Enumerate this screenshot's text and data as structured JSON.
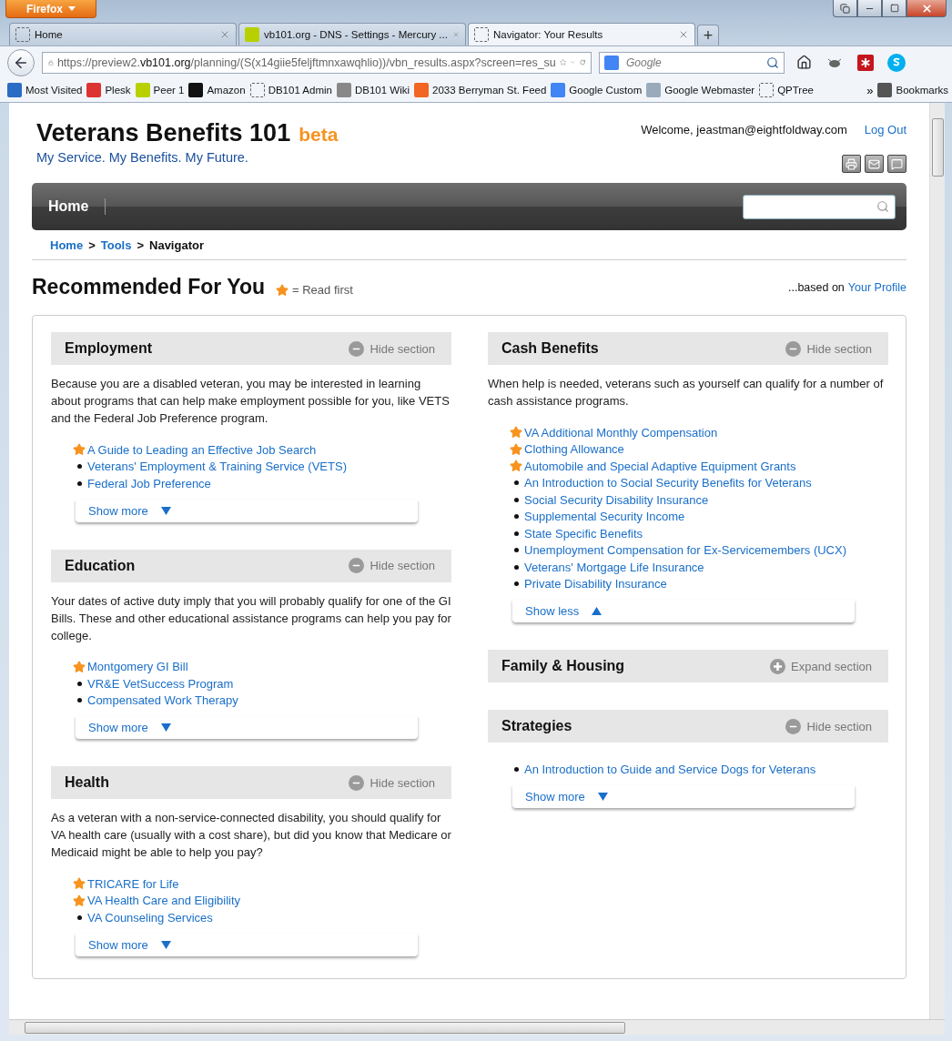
{
  "browser": {
    "app_button": "Firefox",
    "tabs": [
      {
        "title": "Home",
        "selected": false
      },
      {
        "title": "vb101.org - DNS - Settings - Mercury ...",
        "selected": false
      },
      {
        "title": "Navigator: Your Results",
        "selected": true
      }
    ],
    "new_tab": "+",
    "url": {
      "prefix": "https://preview2.",
      "domain": "vb101.org",
      "rest": "/planning/(S(x14giie5feljftmnxawqhlio))/vbn_results.aspx?screen=res_su"
    },
    "search_placeholder": "Google",
    "bookmarks": [
      "Most Visited",
      "Plesk",
      "Peer 1",
      "Amazon",
      "DB101 Admin",
      "DB101 Wiki",
      "2033 Berryman St. Feed",
      "Google Custom",
      "Google Webmaster",
      "QPTree"
    ],
    "overflow": "»",
    "bookmarks_menu": "Bookmarks"
  },
  "site": {
    "title": "Veterans Benefits 101",
    "badge": "beta",
    "tagline": "My Service. My Benefits. My Future.",
    "welcome": "Welcome, jeastman@eightfoldway.com",
    "logout": "Log Out"
  },
  "nav": [
    {
      "label": "Home",
      "selected": true
    }
  ],
  "breadcrumb": [
    {
      "label": "Home",
      "current": false
    },
    {
      "label": "Tools",
      "current": false
    },
    {
      "label": "Navigator",
      "current": true
    }
  ],
  "breadcrumb_separator": ">",
  "heading": "Recommended For You",
  "legend": "= Read first",
  "profile_note": "...based on",
  "profile_link": "Your Profile",
  "columns": [
    [
      {
        "title": "Employment",
        "toggle": "Hide section",
        "expanded": true,
        "description": "Because you are a disabled veteran, you may be interested in learning about programs that can help make employment possible for you, like VETS and the Federal Job Preference program.",
        "links": [
          {
            "label": "A Guide to Leading an Effective Job Search",
            "starred": true
          },
          {
            "label": "Veterans' Employment & Training Service (VETS)",
            "starred": false
          },
          {
            "label": "Federal Job Preference",
            "starred": false
          }
        ],
        "more": {
          "label": "Show more",
          "expanded": false
        }
      },
      {
        "title": "Education",
        "toggle": "Hide section",
        "expanded": true,
        "description": "Your dates of active duty imply that you will probably qualify for one of the GI Bills. These and other educational assistance programs can help you pay for college.",
        "links": [
          {
            "label": "Montgomery GI Bill",
            "starred": true
          },
          {
            "label": "VR&E VetSuccess Program",
            "starred": false
          },
          {
            "label": "Compensated Work Therapy",
            "starred": false
          }
        ],
        "more": {
          "label": "Show more",
          "expanded": false
        }
      },
      {
        "title": "Health",
        "toggle": "Hide section",
        "expanded": true,
        "description": "As a veteran with a non-service-connected disability, you should qualify for VA health care (usually with a cost share), but did you know that Medicare or Medicaid might be able to help you pay?",
        "links": [
          {
            "label": "TRICARE for Life",
            "starred": true
          },
          {
            "label": "VA Health Care and Eligibility",
            "starred": true
          },
          {
            "label": "VA Counseling Services",
            "starred": false
          }
        ],
        "more": {
          "label": "Show more",
          "expanded": false
        }
      }
    ],
    [
      {
        "title": "Cash Benefits",
        "toggle": "Hide section",
        "expanded": true,
        "description": "When help is needed, veterans such as yourself can qualify for a number of cash assistance programs.",
        "links": [
          {
            "label": "VA Additional Monthly Compensation",
            "starred": true
          },
          {
            "label": "Clothing Allowance",
            "starred": true
          },
          {
            "label": "Automobile and Special Adaptive Equipment Grants",
            "starred": true
          },
          {
            "label": "An Introduction to Social Security Benefits for Veterans",
            "starred": false
          },
          {
            "label": "Social Security Disability Insurance",
            "starred": false
          },
          {
            "label": "Supplemental Security Income",
            "starred": false
          },
          {
            "label": "State Specific Benefits",
            "starred": false
          },
          {
            "label": "Unemployment Compensation for Ex-Servicemembers (UCX)",
            "starred": false
          },
          {
            "label": "Veterans' Mortgage Life Insurance",
            "starred": false
          },
          {
            "label": "Private Disability Insurance",
            "starred": false
          }
        ],
        "more": {
          "label": "Show less",
          "expanded": true
        }
      },
      {
        "title": "Family & Housing",
        "toggle": "Expand section",
        "expanded": false
      },
      {
        "title": "Strategies",
        "toggle": "Hide section",
        "expanded": true,
        "links": [
          {
            "label": "An Introduction to Guide and Service Dogs for Veterans",
            "starred": false
          }
        ],
        "more": {
          "label": "Show more",
          "expanded": false
        }
      }
    ]
  ]
}
